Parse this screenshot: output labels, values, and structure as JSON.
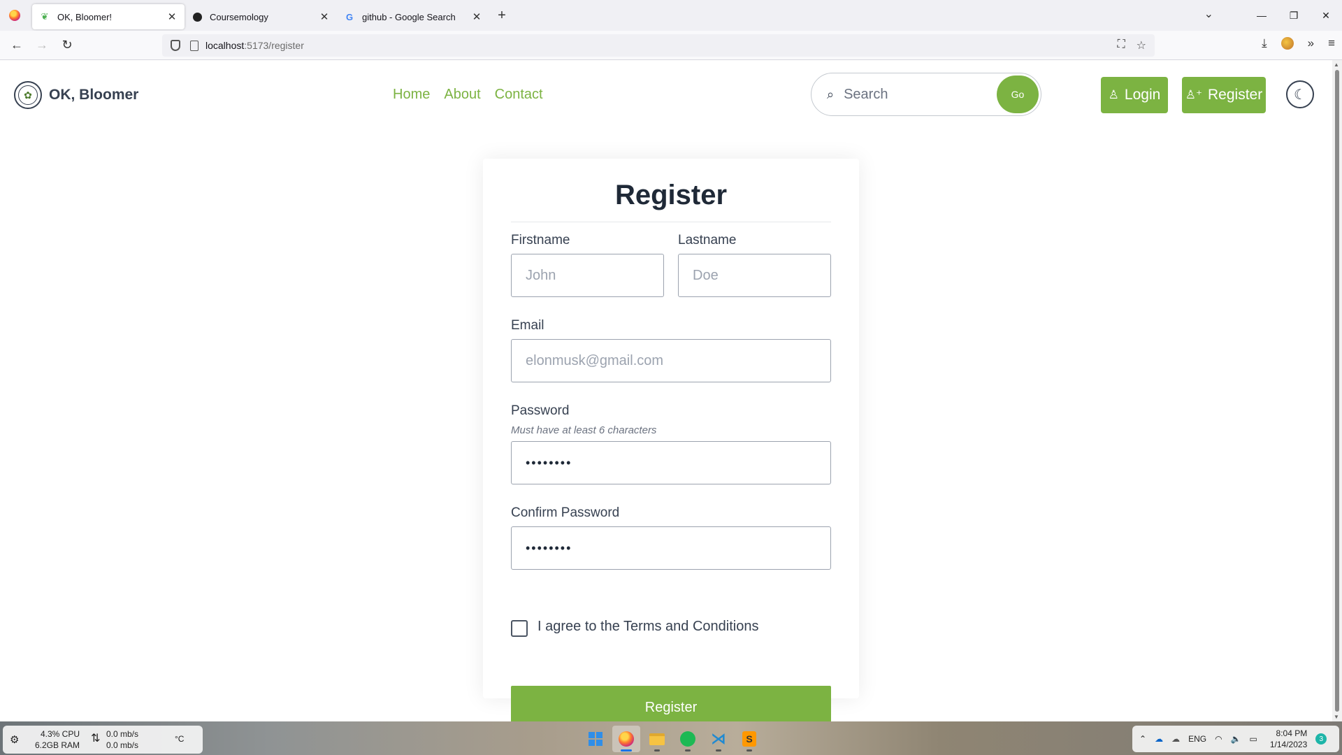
{
  "browser": {
    "tabs": [
      {
        "title": "OK, Bloomer!",
        "icon": "leaf-icon",
        "active": true
      },
      {
        "title": "Coursemology",
        "icon": "coursemology-icon",
        "active": false
      },
      {
        "title": "github - Google Search",
        "icon": "google-icon",
        "active": false
      }
    ],
    "url_host": "localhost",
    "url_path": ":5173/register"
  },
  "site": {
    "brand": "OK, Bloomer",
    "nav": [
      "Home",
      "About",
      "Contact"
    ],
    "search_placeholder": "Search",
    "search_button": "Go",
    "login_label": "Login",
    "register_label": "Register"
  },
  "form": {
    "title": "Register",
    "firstname_label": "Firstname",
    "firstname_placeholder": "John",
    "lastname_label": "Lastname",
    "lastname_placeholder": "Doe",
    "email_label": "Email",
    "email_placeholder": "elonmusk@gmail.com",
    "password_label": "Password",
    "password_hint": "Must have at least 6 characters",
    "password_value": "••••••••",
    "confirm_label": "Confirm Password",
    "confirm_value": "••••••••",
    "terms_label": "I agree to the Terms and Conditions",
    "submit_label": "Register"
  },
  "taskbar": {
    "cpu": "4.3%",
    "cpu_label": "CPU",
    "ram": "6.2GB",
    "ram_label": "RAM",
    "net_up": "0.0 mb/s",
    "net_down": "0.0 mb/s",
    "temp": "°C",
    "lang": "ENG",
    "time": "8:04 PM",
    "date": "1/14/2023",
    "notifications": "3"
  },
  "colors": {
    "accent": "#7cb342",
    "text": "#1f2937"
  }
}
